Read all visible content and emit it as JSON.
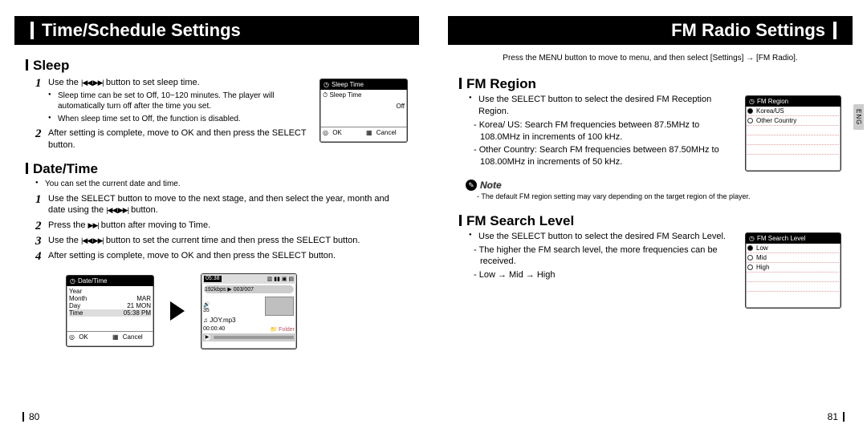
{
  "leftPage": {
    "barTitle": "Time/Schedule Settings",
    "pageNumber": "80",
    "sections": {
      "sleep": {
        "title": "Sleep",
        "step1": "Use the",
        "step1b": "button to set sleep time.",
        "bullet1": "Sleep time can be set to Off, 10~120 minutes. The player will automatically turn off after the time you set.",
        "bullet2": "When sleep time set to Off, the function is disabled.",
        "step2": "After setting is complete, move to OK and then press the SELECT button."
      },
      "datetime": {
        "title": "Date/Time",
        "intro": "You can set the current date and time.",
        "step1": "Use the SELECT button to move to the next stage, and then select the year, month and date using the",
        "step1b": "button.",
        "step2": "Press the",
        "step2b": "button after moving to Time.",
        "step3": "Use the",
        "step3b": "button to set the current time and then press the SELECT button.",
        "step4": "After setting is complete, move to OK and then press the SELECT button."
      }
    },
    "sleepScreen": {
      "title": "Sleep Time",
      "row": "Sleep Time",
      "value": "Off",
      "ok": "OK",
      "cancel": "Cancel"
    },
    "dtScreen": {
      "title": "Date/Time",
      "rows": {
        "year": "Year",
        "month": "Month",
        "monthVal": "MAR",
        "day": "Day",
        "dayVal": "21 MON",
        "time": "Time",
        "timeVal": "05:38 PM"
      },
      "ok": "OK",
      "cancel": "Cancel"
    },
    "playScreen": {
      "clock": "05:38",
      "bitrate": "192kbps",
      "track": "003/007",
      "vol": "35",
      "file": "JOY.mp3",
      "time": "00:00:40",
      "folder": "Folder"
    }
  },
  "rightPage": {
    "barTitle": "FM Radio Settings",
    "pageNumber": "81",
    "tab": "ENG",
    "intro": "Press the MENU button to move to menu, and then select [Settings] → [FM Radio].",
    "fmRegion": {
      "title": "FM Region",
      "bullet": "Use the SELECT button to select the desired FM Reception Region.",
      "dash1": "- Korea/ US: Search FM frequencies between 87.5MHz to 108.0MHz in increments of 100 kHz.",
      "dash2": "- Other Country: Search FM frequencies between 87.50MHz to 108.00MHz in increments of 50 kHz.",
      "note": "Note",
      "noteBody": "- The default FM region setting may vary depending on the target region of the player."
    },
    "fmSearch": {
      "title": "FM Search Level",
      "bullet": "Use the SELECT button to select the desired FM Search Level.",
      "dash1": "- The higher the FM search level, the more frequencies can be received.",
      "dash2": "- Low → Mid → High"
    },
    "regionScreen": {
      "title": "FM Region",
      "opt1": "Korea/US",
      "opt2": "Other Country"
    },
    "searchScreen": {
      "title": "FM Search Level",
      "opt1": "Low",
      "opt2": "Mid",
      "opt3": "High"
    }
  }
}
